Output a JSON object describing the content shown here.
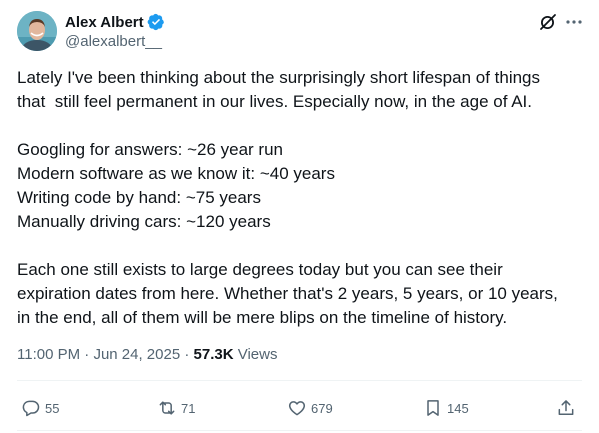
{
  "author": {
    "display_name": "Alex Albert",
    "handle": "@alexalbert__",
    "verified": true,
    "avatar_icon": "avatar-photo"
  },
  "header_icons": [
    "grok-icon",
    "more-icon"
  ],
  "body": {
    "lines": [
      "Lately I've been thinking about the surprisingly short lifespan of things",
      "that  still feel permanent in our lives. Especially now, in the age of AI.",
      "",
      "Googling for answers: ~26 year run",
      "Modern software as we know it: ~40 years",
      "Writing code by hand: ~75 years",
      "Manually driving cars: ~120 years",
      "",
      "Each one still exists to large degrees today but you can see their",
      "expiration dates from here. Whether that's 2 years, 5 years, or 10 years,",
      "in the end, all of them will be mere blips on the timeline of history."
    ]
  },
  "meta": {
    "time": "11:00 PM",
    "separator": " · ",
    "date": "Jun 24, 2025",
    "views_count": "57.3K",
    "views_label": " Views"
  },
  "actions": {
    "replies": "55",
    "reposts": "71",
    "likes": "679",
    "bookmarks": "145"
  },
  "colors": {
    "text_primary": "#0f1419",
    "text_secondary": "#536471",
    "verified_blue": "#1d9bf0",
    "divider": "#eff3f4"
  }
}
